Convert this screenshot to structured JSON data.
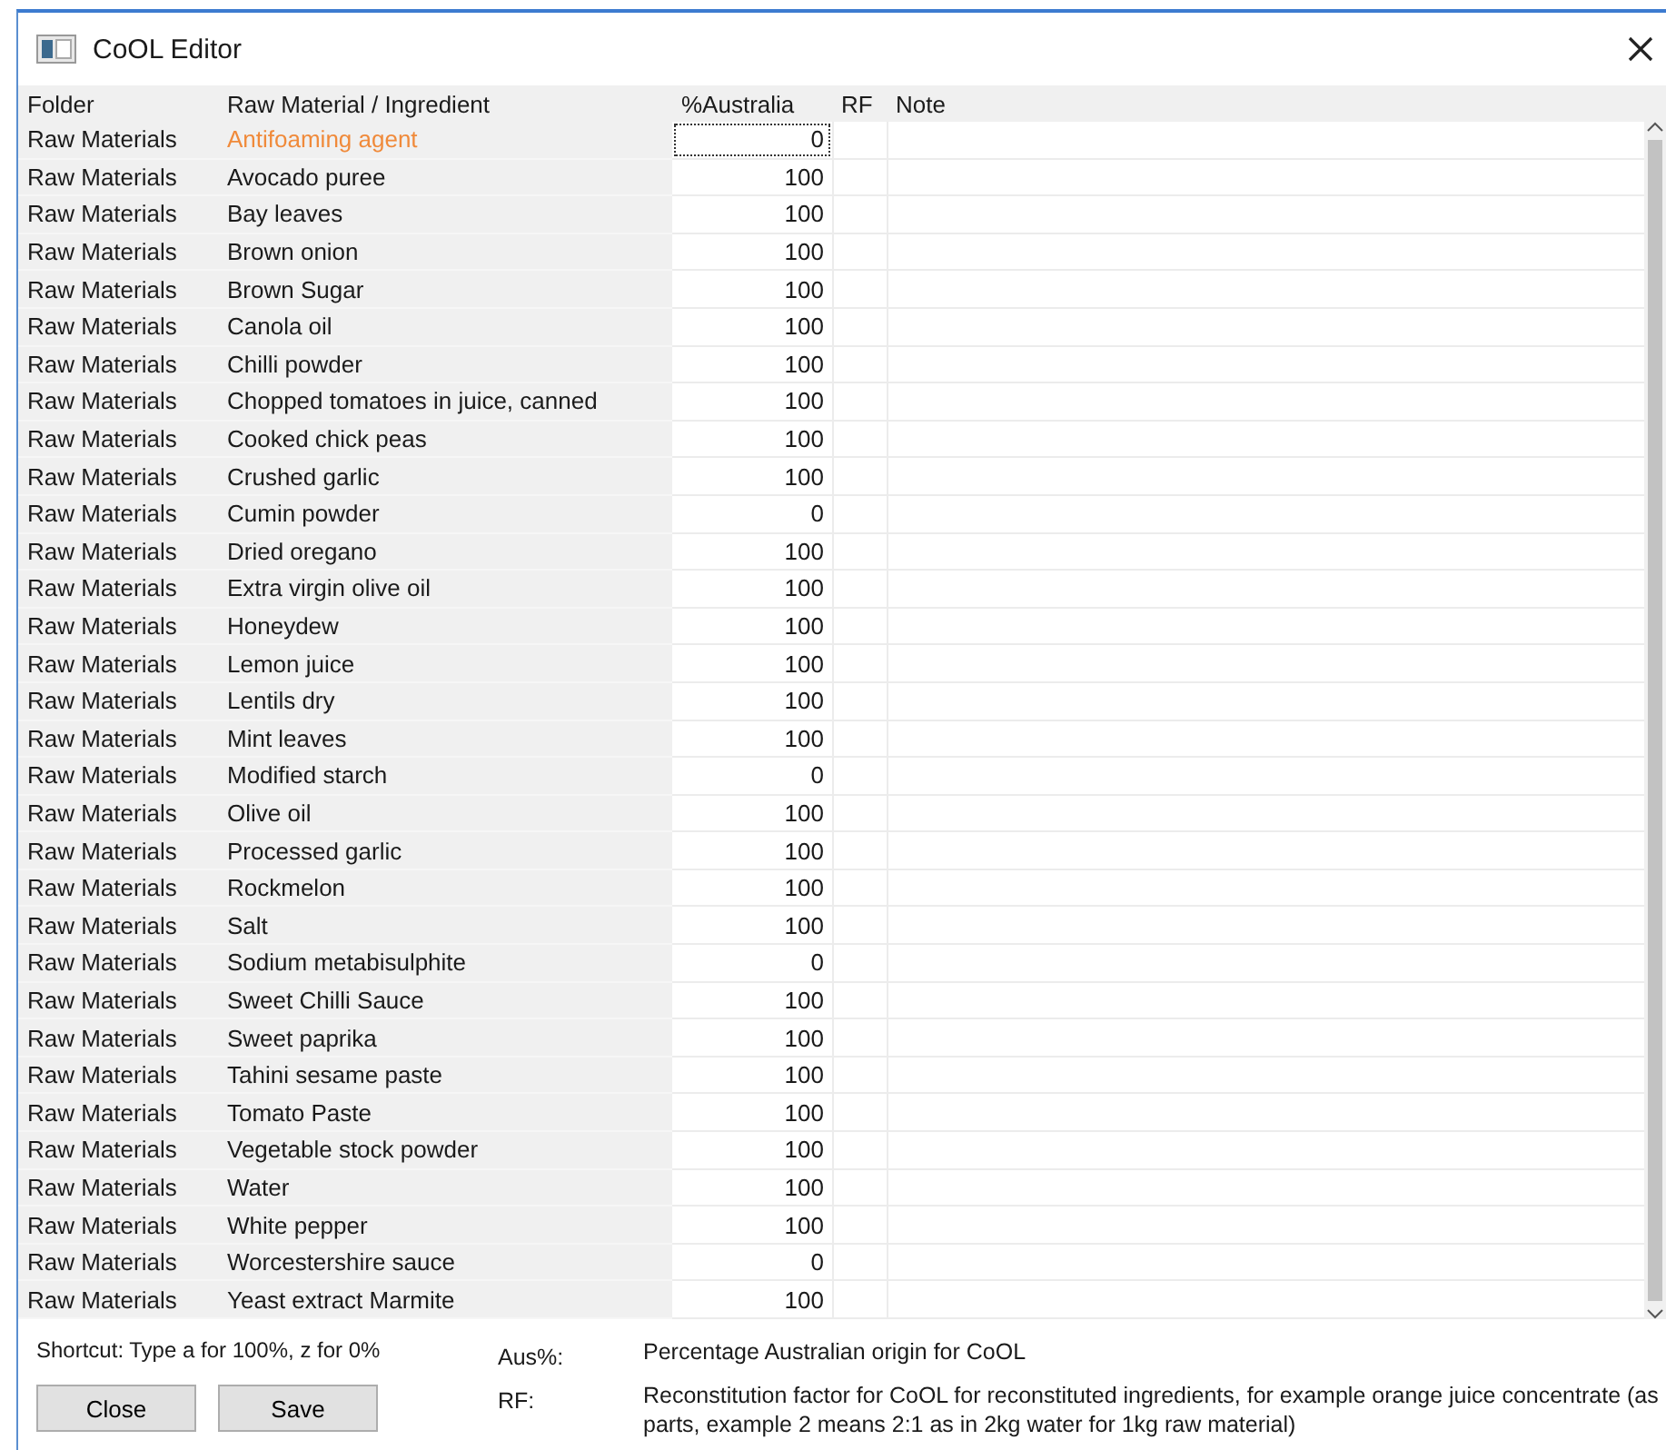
{
  "window": {
    "title": "CoOL Editor"
  },
  "table": {
    "columns": [
      "Folder",
      "Raw Material / Ingredient",
      "%Australia",
      "RF",
      "Note"
    ],
    "rows": [
      {
        "folder": "Raw Materials",
        "ingredient": "Antifoaming agent",
        "australia": "0",
        "selected": true
      },
      {
        "folder": "Raw Materials",
        "ingredient": "Avocado puree",
        "australia": "100",
        "selected": false
      },
      {
        "folder": "Raw Materials",
        "ingredient": "Bay leaves",
        "australia": "100",
        "selected": false
      },
      {
        "folder": "Raw Materials",
        "ingredient": "Brown onion",
        "australia": "100",
        "selected": false
      },
      {
        "folder": "Raw Materials",
        "ingredient": "Brown Sugar",
        "australia": "100",
        "selected": false
      },
      {
        "folder": "Raw Materials",
        "ingredient": "Canola oil",
        "australia": "100",
        "selected": false
      },
      {
        "folder": "Raw Materials",
        "ingredient": "Chilli powder",
        "australia": "100",
        "selected": false
      },
      {
        "folder": "Raw Materials",
        "ingredient": "Chopped tomatoes in juice, canned",
        "australia": "100",
        "selected": false
      },
      {
        "folder": "Raw Materials",
        "ingredient": "Cooked chick peas",
        "australia": "100",
        "selected": false
      },
      {
        "folder": "Raw Materials",
        "ingredient": "Crushed garlic",
        "australia": "100",
        "selected": false
      },
      {
        "folder": "Raw Materials",
        "ingredient": "Cumin powder",
        "australia": "0",
        "selected": false
      },
      {
        "folder": "Raw Materials",
        "ingredient": "Dried oregano",
        "australia": "100",
        "selected": false
      },
      {
        "folder": "Raw Materials",
        "ingredient": "Extra virgin olive oil",
        "australia": "100",
        "selected": false
      },
      {
        "folder": "Raw Materials",
        "ingredient": "Honeydew",
        "australia": "100",
        "selected": false
      },
      {
        "folder": "Raw Materials",
        "ingredient": "Lemon juice",
        "australia": "100",
        "selected": false
      },
      {
        "folder": "Raw Materials",
        "ingredient": "Lentils dry",
        "australia": "100",
        "selected": false
      },
      {
        "folder": "Raw Materials",
        "ingredient": "Mint leaves",
        "australia": "100",
        "selected": false
      },
      {
        "folder": "Raw Materials",
        "ingredient": "Modified starch",
        "australia": "0",
        "selected": false
      },
      {
        "folder": "Raw Materials",
        "ingredient": "Olive oil",
        "australia": "100",
        "selected": false
      },
      {
        "folder": "Raw Materials",
        "ingredient": "Processed garlic",
        "australia": "100",
        "selected": false
      },
      {
        "folder": "Raw Materials",
        "ingredient": "Rockmelon",
        "australia": "100",
        "selected": false
      },
      {
        "folder": "Raw Materials",
        "ingredient": "Salt",
        "australia": "100",
        "selected": false
      },
      {
        "folder": "Raw Materials",
        "ingredient": "Sodium metabisulphite",
        "australia": "0",
        "selected": false
      },
      {
        "folder": "Raw Materials",
        "ingredient": "Sweet Chilli Sauce",
        "australia": "100",
        "selected": false
      },
      {
        "folder": "Raw Materials",
        "ingredient": "Sweet paprika",
        "australia": "100",
        "selected": false
      },
      {
        "folder": "Raw Materials",
        "ingredient": "Tahini sesame paste",
        "australia": "100",
        "selected": false
      },
      {
        "folder": "Raw Materials",
        "ingredient": "Tomato Paste",
        "australia": "100",
        "selected": false
      },
      {
        "folder": "Raw Materials",
        "ingredient": "Vegetable stock powder",
        "australia": "100",
        "selected": false
      },
      {
        "folder": "Raw Materials",
        "ingredient": "Water",
        "australia": "100",
        "selected": false
      },
      {
        "folder": "Raw Materials",
        "ingredient": "White pepper",
        "australia": "100",
        "selected": false
      },
      {
        "folder": "Raw Materials",
        "ingredient": "Worcestershire sauce",
        "australia": "0",
        "selected": false
      },
      {
        "folder": "Raw Materials",
        "ingredient": "Yeast extract Marmite",
        "australia": "100",
        "selected": false
      }
    ]
  },
  "shortcut": "Shortcut: Type a for 100%, z for 0%",
  "legend": [
    {
      "label": "Aus%:",
      "text": "Percentage Australian origin for CoOL"
    },
    {
      "label": "RF:",
      "text": "Reconstitution factor for CoOL for reconstituted ingredients, for example orange juice concentrate (as parts, example 2 means 2:1 as in 2kg water for 1kg raw material)"
    }
  ],
  "buttons": [
    "Close",
    "Save"
  ]
}
